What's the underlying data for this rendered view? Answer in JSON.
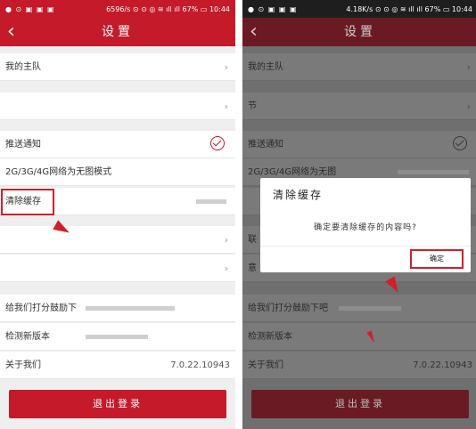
{
  "left": {
    "status": {
      "left": "● ⊙ ▣ ▣ ▣",
      "right": "6596/s ⊙ ⊙ ◎ ≋ ıll ıll 67% ▭ 10:44"
    },
    "nav": {
      "back": "‹",
      "title": "设置"
    },
    "rows": {
      "my_team": "我的主队",
      "push": "推送通知",
      "network": "2G/3G/4G网络为无图模式",
      "clear_cache": "清除缓存",
      "rate": "给我们打分鼓励下",
      "check_update": "检测新版本",
      "about": "关于我们",
      "version": "7.0.22.10943"
    },
    "chevron": "›",
    "logout": "退出登录"
  },
  "right": {
    "status": {
      "left": "● ⊙ ▣ ▣ ▣",
      "right": "4.18K/s ⊙ ⊙ ◎ ≋ ıll ıll 67% ▭ 10:44"
    },
    "nav": {
      "back": "‹",
      "title": "设置"
    },
    "rows": {
      "my_team": "我的主队",
      "row2": "节",
      "push": "推送通知",
      "network": "2G/3G/4G网络为无图",
      "row_a": "联",
      "row_b": "意",
      "rate": "给我们打分鼓励下吧",
      "check_update": "检测新版本",
      "about": "关于我们",
      "version": "7.0.22.10943"
    },
    "chevron": "›",
    "dialog": {
      "title": "清除缓存",
      "message": "确定要清除缓存的内容吗?",
      "ok": "确定"
    },
    "logout": "退出登录"
  }
}
